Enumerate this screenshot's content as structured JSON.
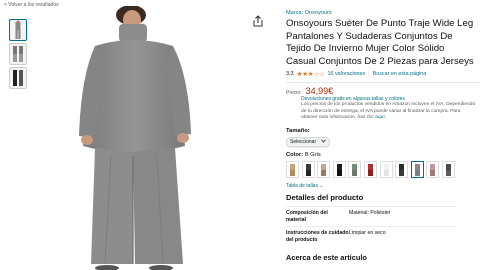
{
  "nav": {
    "back_label": "< Volver a los resultados"
  },
  "product": {
    "brand": "Marca: Onsoyours",
    "title": "Onsoyours Suéter De Punto Traje Wide Leg Pantalones Y Sudaderas Conjuntos De Tejido De Invierno Mujer Color Sólido Casual Conjuntos De 2 Piezas para Jerseys",
    "rating_value": "3,3",
    "stars": "★★★☆☆",
    "rating_out_of_5": 3.3,
    "ratings_count": "16 valoraciones",
    "search_link": "Buscar en esta página",
    "price_label": "Precio:",
    "price": "34,99€",
    "returns_link": "Devoluciones gratis en algunas tallas y colores",
    "tax_note": "Los precios de los productos vendidos en Amazon incluyen el IVA. Dependiendo de tu dirección de entrega, el IVA puede variar al finalizar la compra. Para obtener más información, haz clic",
    "tax_link": "aquí.",
    "size_label": "Tamaño:",
    "size_select": "Seleccionar",
    "color_label": "Color:",
    "color_value": "B Gris",
    "size_table_link": "Tabla de tallas",
    "details_heading": "Detalles del producto",
    "details": [
      {
        "key": "Composición del material",
        "value": "Material: Poliéster"
      },
      {
        "key": "Instrucciones de cuidado del producto",
        "value": "Limpiar en seco"
      }
    ],
    "about_heading": "Acerca de este artículo"
  },
  "colors": {
    "accent": "#007185",
    "price": "#b12704",
    "stars": "#de7921",
    "garment": "#8a8a8a"
  }
}
